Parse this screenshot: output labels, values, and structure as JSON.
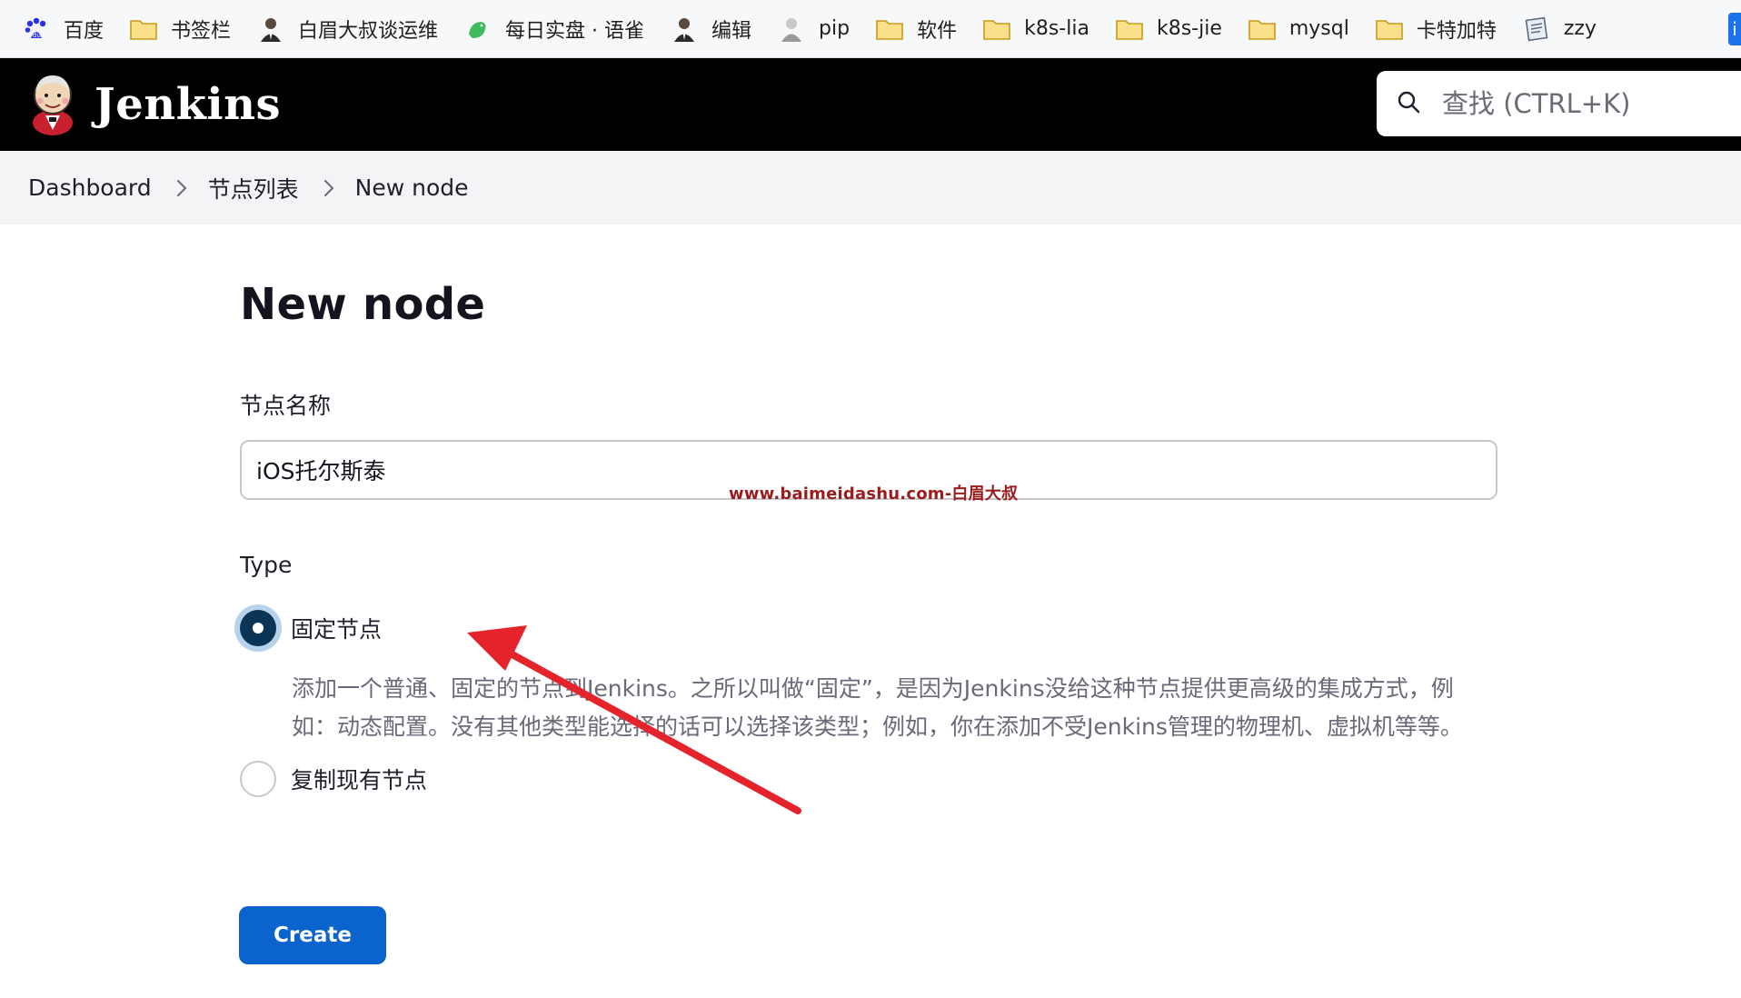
{
  "bookmarks": [
    {
      "icon": "baidu-paw-icon",
      "label": "百度"
    },
    {
      "icon": "folder-icon",
      "label": "书签栏"
    },
    {
      "icon": "avatar-icon",
      "label": "白眉大叔谈运维"
    },
    {
      "icon": "yuque-bird-icon",
      "label": "每日实盘 · 语雀"
    },
    {
      "icon": "avatar-icon",
      "label": "编辑"
    },
    {
      "icon": "avatar-icon",
      "label": "pip"
    },
    {
      "icon": "folder-icon",
      "label": "软件"
    },
    {
      "icon": "folder-icon",
      "label": "k8s-lia"
    },
    {
      "icon": "folder-icon",
      "label": "k8s-jie"
    },
    {
      "icon": "folder-icon",
      "label": "mysql"
    },
    {
      "icon": "folder-icon",
      "label": "卡特加特"
    },
    {
      "icon": "document-icon",
      "label": "zzy"
    }
  ],
  "header": {
    "app_name": "Jenkins",
    "search_placeholder": "查找 (CTRL+K)"
  },
  "breadcrumb": [
    "Dashboard",
    "节点列表",
    "New node"
  ],
  "page": {
    "title": "New node",
    "name_label": "节点名称",
    "name_value": "iOS托尔斯泰",
    "watermark": "www.baimeidashu.com-白眉大叔",
    "type_label": "Type",
    "options": [
      {
        "label": "固定节点",
        "checked": true,
        "description": "添加一个普通、固定的节点到Jenkins。之所以叫做“固定”，是因为Jenkins没给这种节点提供更高级的集成方式，例如：动态配置。没有其他类型能选择的话可以选择该类型；例如，你在添加不受Jenkins管理的物理机、虚拟机等等。"
      },
      {
        "label": "复制现有节点",
        "checked": false
      }
    ],
    "create_label": "Create"
  },
  "colors": {
    "header_bg": "#000000",
    "primary_button": "#0b63ce",
    "radio_checked": "#0b3556",
    "annotation_arrow": "#e5232b",
    "watermark": "#9b1c1c"
  }
}
